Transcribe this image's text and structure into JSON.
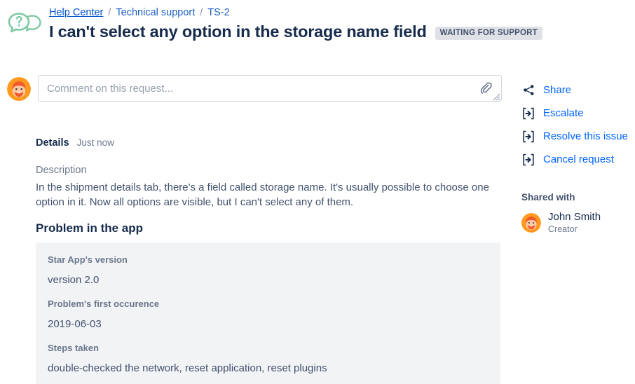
{
  "header": {
    "logo_icon": "help-speech-bubble-icon",
    "breadcrumb": {
      "home": "Help Center",
      "separator": "/",
      "category": "Technical support",
      "ticket": "TS-2"
    },
    "title": "I can't select any option in the storage name field",
    "status": "WAITING FOR SUPPORT"
  },
  "comment": {
    "avatar_name": "user-avatar",
    "placeholder": "Comment on this request...",
    "value": "",
    "attach_icon": "paperclip-icon",
    "resize_icon": "resize-grip-icon"
  },
  "details": {
    "tab_label": "Details",
    "timestamp": "Just now",
    "description_label": "Description",
    "description_body": "In the shipment details tab, there's a field called storage name. It's usually possible to choose one option in it. Now all options are visible, but I can't select any of them.",
    "section_title": "Problem in the app",
    "fields": [
      {
        "label": "Star App's version",
        "value": "version 2.0"
      },
      {
        "label": "Problem's first occurence",
        "value": "2019-06-03"
      },
      {
        "label": "Steps taken",
        "value": "double-checked the network, reset application, reset plugins"
      }
    ]
  },
  "sidebar": {
    "actions": [
      {
        "label": "Share",
        "icon": "share-icon"
      },
      {
        "label": "Escalate",
        "icon": "escalate-arrow-icon"
      },
      {
        "label": "Resolve this issue",
        "icon": "escalate-arrow-icon"
      },
      {
        "label": "Cancel request",
        "icon": "escalate-arrow-icon"
      }
    ],
    "shared_with_label": "Shared with",
    "people": [
      {
        "name": "John Smith",
        "role": "Creator"
      }
    ]
  },
  "colors": {
    "link": "#0065FF",
    "breadcrumb_link": "#0052CC",
    "title": "#172B4D",
    "badge_bg": "#DFE1E6",
    "badge_text": "#42526E",
    "panel_bg": "#F2F3F5",
    "muted_text": "#6B778C",
    "body_text": "#42526E",
    "logo_green": "#7FC9A4",
    "avatar_orange": "#FF9A1F"
  }
}
